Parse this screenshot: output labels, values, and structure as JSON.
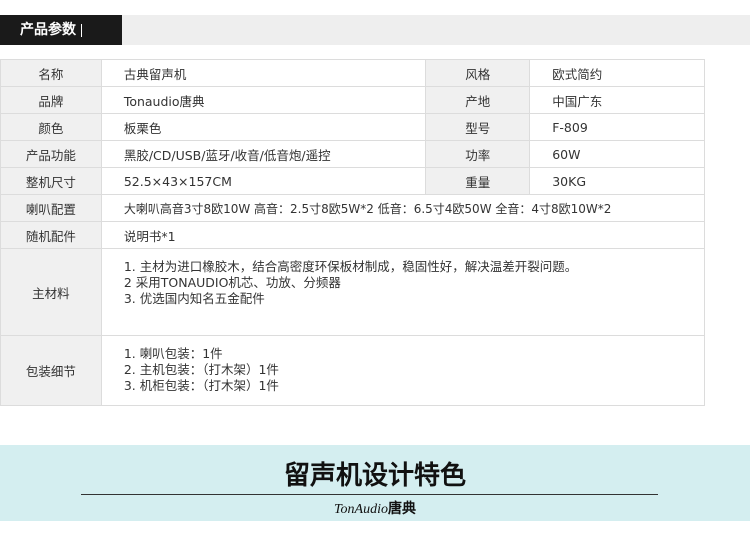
{
  "header": {
    "tab_label": "产品参数"
  },
  "specs": {
    "name_label": "名称",
    "name_value": "古典留声机",
    "style_label": "风格",
    "style_value": "欧式简约",
    "brand_label": "品牌",
    "brand_value": "Tonaudio唐典",
    "origin_label": "产地",
    "origin_value": "中国广东",
    "color_label": "颜色",
    "color_value": "板栗色",
    "model_label": "型号",
    "model_value": "F-809",
    "function_label": "产品功能",
    "function_value": "黑胶/CD/USB/蓝牙/收音/低音炮/遥控",
    "power_label": "功率",
    "power_value": "60W",
    "size_label": "整机尺寸",
    "size_value": "52.5×43×157CM",
    "weight_label": "重量",
    "weight_value": "30KG",
    "speaker_label": "喇叭配置",
    "speaker_value": "大喇叭高音3寸8欧10W 高音：2.5寸8欧5W*2  低音：6.5寸4欧50W  全音：4寸8欧10W*2",
    "accessory_label": "随机配件",
    "accessory_value": "说明书*1",
    "material_label": "主材料",
    "material_lines": [
      "1. 主材为进口橡胶木，结合高密度环保板材制成，稳固性好，解决温差开裂问题。",
      "2 采用TONAUDIO机芯、功放、分频器",
      "3. 优选国内知名五金配件"
    ],
    "packing_label": "包装细节",
    "packing_lines": [
      "1. 喇叭包装：1件",
      "2. 主机包装：（打木架）1件",
      "3. 机柜包装：（打木架）1件"
    ]
  },
  "banner": {
    "title": "留声机设计特色",
    "brand_latin": "TonAudio",
    "brand_cjk": "唐典"
  },
  "colors": {
    "header_bg": "#1a1a1a",
    "banner_bg": "#d4eef0",
    "label_cell_bg": "#f0f0f0"
  }
}
